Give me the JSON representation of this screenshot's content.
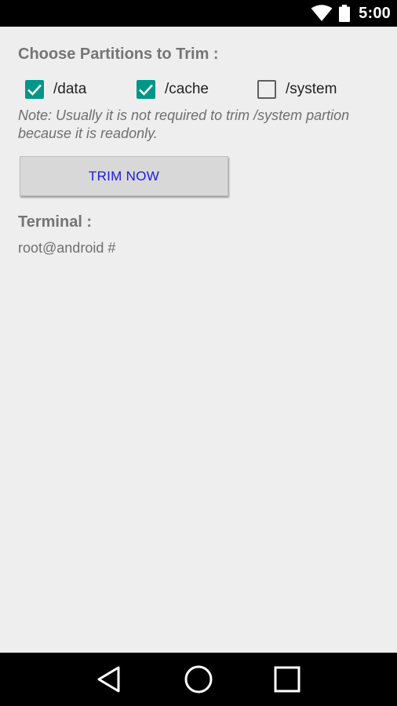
{
  "status_bar": {
    "time": "5:00",
    "icons": [
      "wifi-icon",
      "battery-icon"
    ]
  },
  "partitions": {
    "title": "Choose Partitions to Trim :",
    "options": [
      {
        "label": "/data",
        "checked": true
      },
      {
        "label": "/cache",
        "checked": true
      },
      {
        "label": "/system",
        "checked": false
      }
    ],
    "note": "Note: Usually it is not required to trim /system partion because it is readonly."
  },
  "actions": {
    "trim_label": "TRIM NOW"
  },
  "terminal": {
    "title": "Terminal :",
    "output": "root@android #"
  },
  "nav_bar": {
    "icons": [
      "back-icon",
      "home-icon",
      "recents-icon"
    ]
  },
  "colors": {
    "accent": "#009688",
    "button_text": "#1a1adc",
    "background": "#eeeeee"
  }
}
